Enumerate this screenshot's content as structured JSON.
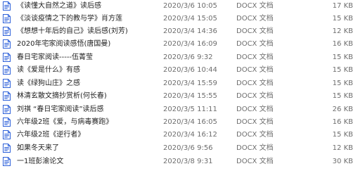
{
  "icon": "docx-file-icon",
  "colors": {
    "icon_blue": "#2b5fd9",
    "text": "#1f1f1f",
    "meta_text": "#6d6d6d"
  },
  "files": [
    {
      "name": "《读懂大自然之道》读后感",
      "date": "2020/3/6 10:05",
      "type": "DOCX 文档",
      "size": "17 KB"
    },
    {
      "name": "《淡谈疫情之下的教与学》肖方莲",
      "date": "2020/3/4 15:05",
      "type": "DOCX 文档",
      "size": "15 KB"
    },
    {
      "name": "《想想十年后的自己》读后感(刘芳)",
      "date": "2020/3/4 14:36",
      "type": "DOCX 文档",
      "size": "12 KB"
    },
    {
      "name": "2020年宅家阅读感悟(唐国曼)",
      "date": "2020/3/4 16:09",
      "type": "DOCX 文档",
      "size": "16 KB"
    },
    {
      "name": "春日宅家阅读-----伍菁莹",
      "date": "2020/3/6 9:32",
      "type": "DOCX 文档",
      "size": "15 KB"
    },
    {
      "name": "读《爱是什么》有感",
      "date": "2020/3/6 10:44",
      "type": "DOCX 文档",
      "size": "15 KB"
    },
    {
      "name": "读《绿狗山庄》之感",
      "date": "2020/3/4 15:59",
      "type": "DOCX 文档",
      "size": "15 KB"
    },
    {
      "name": "林清玄散文摘抄赏析(何长春)",
      "date": "2020/3/4 15:55",
      "type": "DOCX 文档",
      "size": "15 KB"
    },
    {
      "name": "刘祺 “春日宅家阅读”读后感",
      "date": "2020/3/5 11:11",
      "type": "DOCX 文档",
      "size": "26 KB"
    },
    {
      "name": "六年级2班《爱，与病毒赛跑》",
      "date": "2020/3/4 16:05",
      "type": "DOCX 文档",
      "size": "16 KB"
    },
    {
      "name": "六年级2班《逆行者》",
      "date": "2020/3/4 16:12",
      "type": "DOCX 文档",
      "size": "15 KB"
    },
    {
      "name": "如果冬天来了",
      "date": "2020/3/6 9:56",
      "type": "DOCX 文档",
      "size": "12 KB"
    },
    {
      "name": "一1班彭渝论文",
      "date": "2020/3/8 9:31",
      "type": "DOCX 文档",
      "size": "30 KB"
    }
  ]
}
